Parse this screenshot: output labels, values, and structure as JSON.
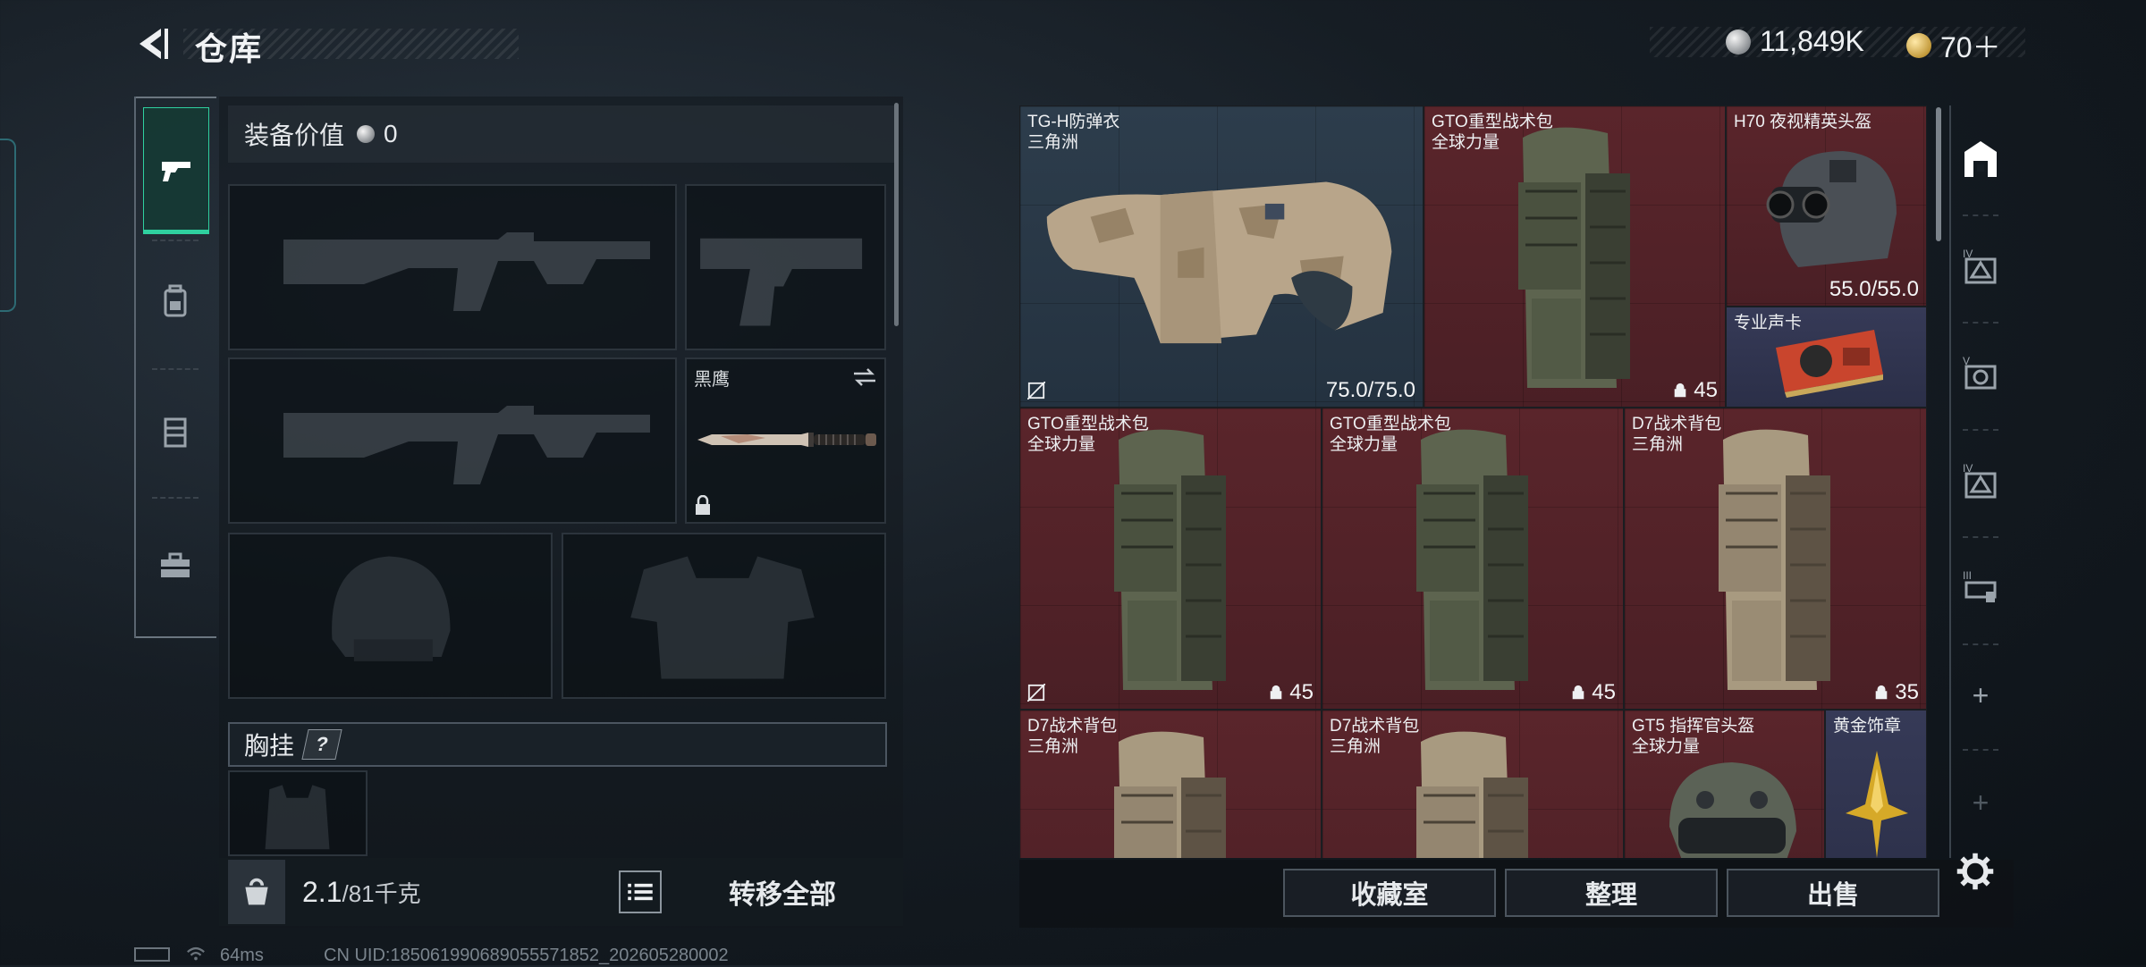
{
  "header": {
    "title": "仓库"
  },
  "currency": [
    {
      "icon": "silver-coin-icon",
      "amount": "11,849K"
    },
    {
      "icon": "gold-coin-icon",
      "amount": "70＋"
    }
  ],
  "left_tabs": [
    {
      "name": "pistol-icon",
      "active": true
    },
    {
      "name": "backpack-icon",
      "active": false
    },
    {
      "name": "vest-icon",
      "active": false
    },
    {
      "name": "toolbox-icon",
      "active": false
    }
  ],
  "equipment": {
    "value_label": "装备价值",
    "value": "0",
    "knife_label": "黑鹰",
    "vest_section": "胸挂",
    "help_mark": "?"
  },
  "footer_left": {
    "weight_current": "2.1",
    "weight_max": "/81千克",
    "transfer_all": "转移全部"
  },
  "warehouse": {
    "items": [
      {
        "name": "TG-H防弹衣",
        "sub": "三角洲",
        "value": "75.0/75.0",
        "color": "blue",
        "no_trade": true
      },
      {
        "name": "GTO重型战术包",
        "sub": "全球力量",
        "value": "45",
        "color": "red",
        "no_trade": false
      },
      {
        "name": "H70 夜视精英头盔",
        "sub": "",
        "value": "55.0/55.0",
        "color": "red",
        "no_trade": false
      },
      {
        "name": "专业声卡",
        "sub": "",
        "value": "",
        "color": "navy",
        "no_trade": false
      },
      {
        "name": "GTO重型战术包",
        "sub": "全球力量",
        "value": "45",
        "color": "red",
        "no_trade": true
      },
      {
        "name": "GTO重型战术包",
        "sub": "全球力量",
        "value": "45",
        "color": "red",
        "no_trade": false
      },
      {
        "name": "D7战术背包",
        "sub": "三角洲",
        "value": "35",
        "color": "red",
        "no_trade": false
      },
      {
        "name": "D7战术背包",
        "sub": "三角洲",
        "value": "",
        "color": "red",
        "no_trade": false
      },
      {
        "name": "D7战术背包",
        "sub": "三角洲",
        "value": "",
        "color": "red",
        "no_trade": false
      },
      {
        "name": "GT5 指挥官头盔",
        "sub": "全球力量",
        "value": "",
        "color": "red",
        "no_trade": false
      },
      {
        "name": "黄金饰章",
        "sub": "",
        "value": "",
        "color": "navy",
        "no_trade": false
      }
    ]
  },
  "right_tabs": [
    {
      "name": "warehouse-main-icon",
      "label": ""
    },
    {
      "name": "storage-iv-icon",
      "label": "IV"
    },
    {
      "name": "storage-v-icon",
      "label": "V"
    },
    {
      "name": "storage-iv-b-icon",
      "label": "IV"
    },
    {
      "name": "storage-iii-icon",
      "label": "III"
    },
    {
      "name": "add-storage-icon",
      "label": "+"
    },
    {
      "name": "add-storage-disabled-icon",
      "label": "+"
    }
  ],
  "bottom_buttons": {
    "collection": "收藏室",
    "organize": "整理",
    "sell": "出售"
  },
  "status_bar": {
    "ping": "64ms",
    "uid": "CN UID:1850619906890555718​52_202605280002"
  },
  "colors": {
    "accent_green": "#2fd09f",
    "item_red": "#5a252b",
    "item_blue": "#2d3d4c",
    "item_navy": "#363a57"
  }
}
